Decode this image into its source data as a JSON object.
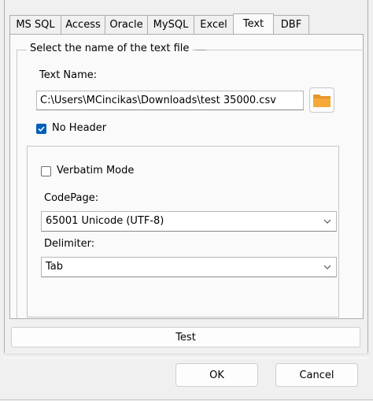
{
  "tabs": [
    {
      "label": "MS SQL",
      "active": false
    },
    {
      "label": "Access",
      "active": false
    },
    {
      "label": "Oracle",
      "active": false
    },
    {
      "label": "MySQL",
      "active": false
    },
    {
      "label": "Excel",
      "active": false
    },
    {
      "label": "Text",
      "active": true
    },
    {
      "label": "DBF",
      "active": false
    }
  ],
  "group": {
    "title": "Select the name of the text file"
  },
  "text_name": {
    "label": "Text Name:",
    "value": "C:\\Users\\MCincikas\\Downloads\\test 35000.csv",
    "browse_icon": "folder-icon"
  },
  "no_header": {
    "label": "No Header",
    "checked": true
  },
  "verbatim": {
    "label": "Verbatim Mode",
    "checked": false
  },
  "codepage": {
    "label": "CodePage:",
    "value": "65001  Unicode (UTF-8)"
  },
  "delimiter": {
    "label": "Delimiter:",
    "value": "Tab"
  },
  "test_button": {
    "label": "Test"
  },
  "ok_button": {
    "label": "OK"
  },
  "cancel_button": {
    "label": "Cancel"
  },
  "colors": {
    "accent": "#005fb8",
    "folder": "#f0a030"
  }
}
